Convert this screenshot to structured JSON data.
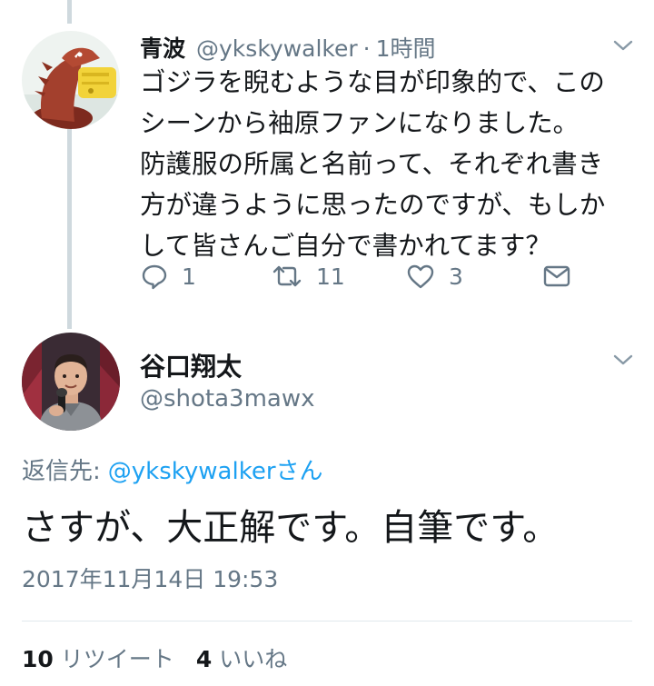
{
  "colors": {
    "text_primary": "#14171a",
    "text_secondary": "#657786",
    "link": "#1da1f2",
    "thread_line": "#cfd9de",
    "divider": "#e1e8ed"
  },
  "reply_tweet": {
    "avatar_icon": "godzilla-figure-avatar",
    "author_name": "青波",
    "author_handle": "@ykskywalker",
    "separator": "·",
    "time": "1時間",
    "body_lines": [
      "ゴジラを睨むような目が印象的で、この",
      "シーンから袖原ファンになりました。",
      "防護服の所属と名前って、それぞれ書き",
      "方が違うように思ったのですが、もしか",
      "して皆さんご自分で書かれてます？"
    ],
    "actions": {
      "reply_icon": "reply-icon",
      "reply_count": "1",
      "retweet_icon": "retweet-icon",
      "retweet_count": "11",
      "like_icon": "heart-icon",
      "like_count": "3",
      "dm_icon": "envelope-icon"
    }
  },
  "main_tweet": {
    "avatar_icon": "man-with-microphone-avatar",
    "author_name": "谷口翔太",
    "author_handle": "@shota3mawx",
    "replying_to_label": "返信先:",
    "replying_to_mention": "@ykskywalkerさん",
    "text": "さすが、大正解です。自筆です。",
    "timestamp": "2017年11月14日 19:53",
    "stats": {
      "retweet_count": "10",
      "retweet_label": "リツイート",
      "like_count": "4",
      "like_label": "いいね"
    }
  }
}
